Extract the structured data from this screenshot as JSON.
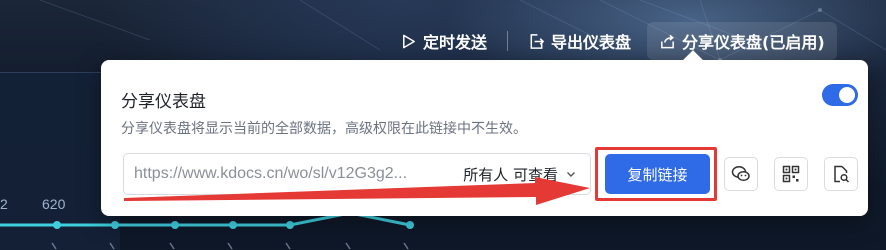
{
  "toolbar": {
    "schedule_label": "定时发送",
    "export_label": "导出仪表盘",
    "share_label": "分享仪表盘(已启用)"
  },
  "chart": {
    "labels": [
      "2",
      "620"
    ]
  },
  "share_popover": {
    "title": "分享仪表盘",
    "description": "分享仪表盘将显示当前的全部数据，高级权限在此链接中不生效。",
    "toggle_on": true,
    "link_url": "https://www.kdocs.cn/wo/sl/v12G3g2...",
    "permission": "所有人 可查看",
    "copy_button": "复制链接"
  },
  "icons": {
    "schedule": "send-icon",
    "export": "export-icon",
    "share": "share-icon",
    "dropdown": "chevron-down-icon",
    "wechat": "wechat-icon",
    "qrcode": "qrcode-icon",
    "preview": "file-search-icon"
  },
  "colors": {
    "accent": "#2f6be7",
    "annotation": "#e53935",
    "chart_line": "#3fd0e0"
  }
}
